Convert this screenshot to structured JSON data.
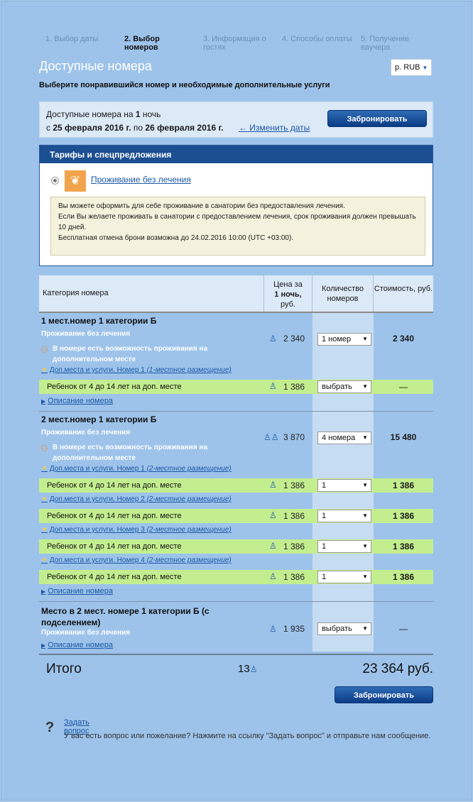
{
  "steps": [
    {
      "label": "1. Выбор даты"
    },
    {
      "label": "2. Выбор номеров"
    },
    {
      "label": "3. Информация о гостях"
    },
    {
      "label": "4. Способы оплаты"
    },
    {
      "label": "5. Получение ваучера"
    }
  ],
  "header": {
    "title": "Доступные номера",
    "currency": "р. RUB",
    "subtitle": "Выберите понравившийся номер и необходимые дополнительные услуги"
  },
  "dates": {
    "line1_prefix": "Доступные номера на ",
    "nights": "1",
    "line1_suffix": " ночь",
    "from_prefix": "с ",
    "from": "25 февраля 2016 г.",
    "to_prefix": " по ",
    "to": "26 февраля 2016 г.",
    "change": "← Изменить даты",
    "book": "Забронировать"
  },
  "tariffs": {
    "title": "Тарифы и спецпредложения",
    "option": "Проживание без лечения",
    "info": [
      "Вы можете оформить для себе проживание в санатории без предоставления лечения.",
      "Если Вы желаете проживать в санатории с предоставлением лечения, срок проживания должен превышать 10 дней.",
      "Бесплатная отмена брони возможна до 24.02.2016 10:00 (UTC +03:00)."
    ]
  },
  "table": {
    "headers": {
      "category": "Категория номера",
      "price_a": "Цена за",
      "price_b": "1 ночь,",
      "price_c": "руб.",
      "qty": "Количество номеров",
      "cost": "Стоимость, руб."
    },
    "room1": {
      "title": "1 мест.номер 1 категории Б",
      "tariff": "Проживание без лечения",
      "extra": "В номере есть возможность проживания на дополнительном месте",
      "price": "2 340",
      "select": "1 номер",
      "total": "2 340",
      "service_link": "Доп.места и услуги. Номер 1",
      "service_note": "(1-местное размещение)",
      "child": "Ребенок от 4 до 14 лет на доп. месте",
      "child_price": "1 386",
      "child_select": "выбрать",
      "child_total": "—",
      "desc": "Описание номера"
    },
    "room2": {
      "title": "2 мест.номер 1 категории Б",
      "tariff": "Проживание без лечения",
      "extra": "В номере есть возможность проживания на дополнительном месте",
      "price": "3 870",
      "select": "4 номера",
      "total": "15 480",
      "services": [
        {
          "link": "Доп.места и услуги. Номер 1",
          "note": "(2-местное размещение)",
          "child": "Ребенок от 4 до 14 лет на доп. месте",
          "price": "1 386",
          "select": "1",
          "total": "1 386"
        },
        {
          "link": "Доп.места и услуги. Номер 2",
          "note": "(2-местное размещение)",
          "child": "Ребенок от 4 до 14 лет на доп. месте",
          "price": "1 386",
          "select": "1",
          "total": "1 386"
        },
        {
          "link": "Доп.места и услуги. Номер 3",
          "note": "(2-местное размещение)",
          "child": "Ребенок от 4 до 14 лет на доп. месте",
          "price": "1 386",
          "select": "1",
          "total": "1 386"
        },
        {
          "link": "Доп.места и услуги. Номер 4",
          "note": "(2-местное размещение)",
          "child": "Ребенок от 4 до 14 лет на доп. месте",
          "price": "1 386",
          "select": "1",
          "total": "1 386"
        }
      ],
      "desc": "Описание номера"
    },
    "room3": {
      "title_1": "Место в 2 мест. номере 1 категории Б (с",
      "title_2": "подселением)",
      "tariff": "Проживание без лечения",
      "price": "1 935",
      "select": "выбрать",
      "total": "—",
      "desc": "Описание номера"
    }
  },
  "summary": {
    "label": "Итого",
    "count": "13",
    "sum": "23 364 руб.",
    "book": "Забронировать"
  },
  "question": {
    "link": "Задать вопрос",
    "text": "У вас есть вопрос или пожелание? Нажмите на ссылку \"Задать вопрос\" и отправьте нам сообщение."
  },
  "colors": {
    "background": "#9dc3ea",
    "header_bar": "#1c4f91",
    "service_row": "#c3ee8f",
    "button": "#0b3c86",
    "link": "#1a57a6"
  }
}
